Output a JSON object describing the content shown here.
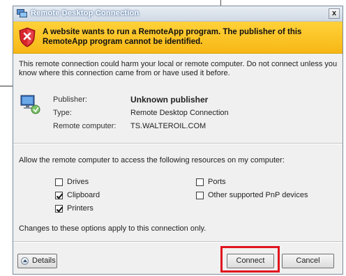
{
  "window": {
    "title": "Remote Desktop Connection",
    "close_glyph": "x"
  },
  "warning": {
    "line1": "A website wants to run a RemoteApp program. The publisher of this",
    "line2": "RemoteApp program cannot be identified.",
    "icon": "security-warning-shield-icon"
  },
  "intro": {
    "text": "This remote connection could harm your local or remote computer. Do not connect unless you know where this connection came from or have used it before."
  },
  "info": {
    "icon": "remote-desktop-computer-icon",
    "publisher_label": "Publisher:",
    "publisher_value": "Unknown publisher",
    "type_label": "Type:",
    "type_value": "Remote Desktop Connection",
    "computer_label": "Remote computer:",
    "computer_value": "TS.WALTEROIL.COM"
  },
  "resources": {
    "prompt": "Allow the remote computer to access the following resources on my computer:",
    "drives": {
      "label": "Drives",
      "checked": false
    },
    "clipboard": {
      "label": "Clipboard",
      "checked": true
    },
    "printers": {
      "label": "Printers",
      "checked": true
    },
    "ports": {
      "label": "Ports",
      "checked": false
    },
    "pnp": {
      "label": "Other supported PnP devices",
      "checked": false
    },
    "note": "Changes to these options apply to this connection only."
  },
  "buttons": {
    "details": "Details",
    "connect": "Connect",
    "cancel": "Cancel"
  },
  "colors": {
    "warning_band": "#f7b715",
    "highlight": "#e0141e"
  }
}
